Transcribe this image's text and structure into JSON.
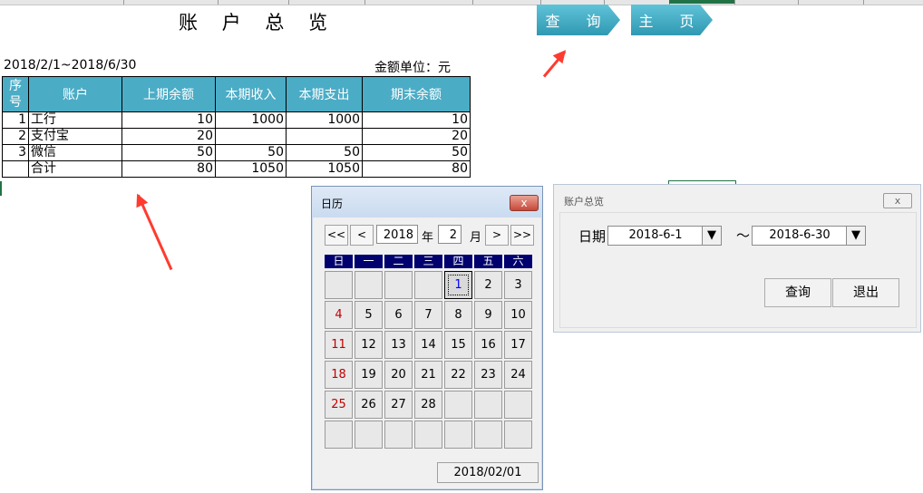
{
  "sheet": {
    "title": "账 户 总 览",
    "period": "2018/2/1~2018/6/30",
    "unit": "金额单位：元",
    "header_buttons": {
      "query": "查 询",
      "home": "主 页"
    },
    "columns": [
      "序号",
      "账户",
      "上期余额",
      "本期收入",
      "本期支出",
      "期末余额"
    ],
    "rows": [
      {
        "no": "1",
        "account": "工行",
        "opening": "10",
        "income": "1000",
        "expense": "1000",
        "closing": "10"
      },
      {
        "no": "2",
        "account": "支付宝",
        "opening": "20",
        "income": "",
        "expense": "",
        "closing": "20"
      },
      {
        "no": "3",
        "account": "微信",
        "opening": "50",
        "income": "50",
        "expense": "50",
        "closing": "50"
      },
      {
        "no": "",
        "account": "合计",
        "opening": "80",
        "income": "1050",
        "expense": "1050",
        "closing": "80"
      }
    ],
    "accent_color": "#4bacc6"
  },
  "calendar": {
    "title": "日历",
    "close_label": "x",
    "nav": {
      "prev_year": "<<",
      "prev_month": "<",
      "next_month": ">",
      "next_year": ">>"
    },
    "year": "2018",
    "year_label": "年",
    "month": "2",
    "month_label": "月",
    "weekdays": [
      "日",
      "一",
      "二",
      "三",
      "四",
      "五",
      "六"
    ],
    "weeks": [
      [
        "",
        "",
        "",
        "",
        "1",
        "2",
        "3"
      ],
      [
        "4",
        "5",
        "6",
        "7",
        "8",
        "9",
        "10"
      ],
      [
        "11",
        "12",
        "13",
        "14",
        "15",
        "16",
        "17"
      ],
      [
        "18",
        "19",
        "20",
        "21",
        "22",
        "23",
        "24"
      ],
      [
        "25",
        "26",
        "27",
        "28",
        "",
        "",
        ""
      ],
      [
        "",
        "",
        "",
        "",
        "",
        "",
        ""
      ]
    ],
    "selected_day": "1",
    "selected_date": "2018/02/01"
  },
  "dialog": {
    "title": "账户总览",
    "close_label": "x",
    "date_label": "日期",
    "from_date": "2018-6-1",
    "to_date": "2018-6-30",
    "separator": "～",
    "dropdown_glyph": "▼",
    "query_button": "查询",
    "exit_button": "退出"
  }
}
